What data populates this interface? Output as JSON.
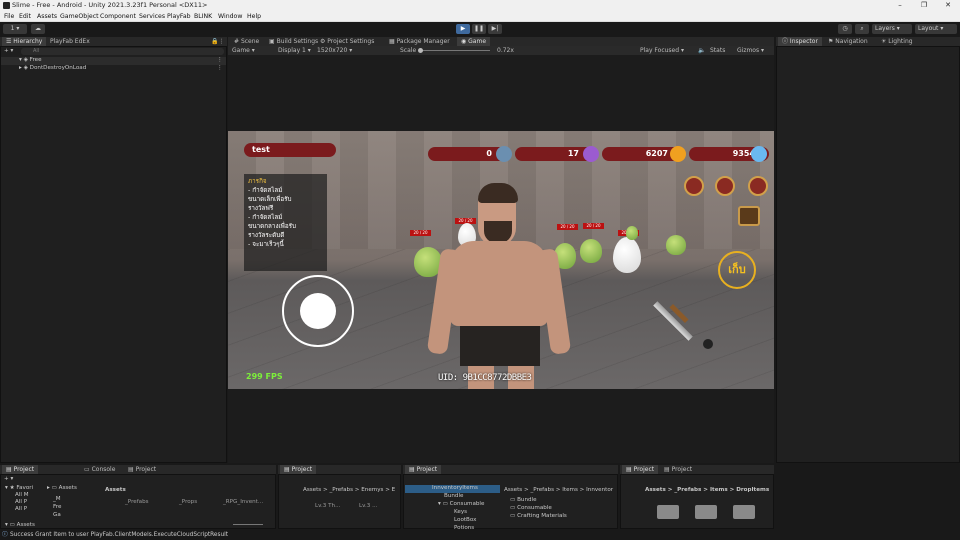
{
  "window": {
    "title": "Slime - Free - Android - Unity 2021.3.23f1 Personal <DX11>"
  },
  "menu": [
    "File",
    "Edit",
    "Assets",
    "GameObject",
    "Component",
    "Services",
    "PlayFab",
    "BLINK",
    "Window",
    "Help"
  ],
  "toolbar": {
    "account": "1 ▾",
    "layers": "Layers",
    "layout": "Layout"
  },
  "hierarchy": {
    "tabs": [
      "Hierarchy",
      "PlayFab EdEx"
    ],
    "search_placeholder": "All",
    "items": [
      "Free",
      "DontDestroyOnLoad"
    ]
  },
  "center_tabs": [
    "Scene",
    "Build Settings",
    "Project Settings",
    "Package Manager",
    "Game"
  ],
  "game_toolbar": {
    "mode": "Game",
    "display": "Display 1",
    "resolution": "1520x720",
    "scale_label": "Scale",
    "scale_value": "0.72x",
    "play_focused": "Play Focused",
    "stats": "Stats",
    "gizmos": "Gizmos"
  },
  "inspector_tabs": [
    "Inspector",
    "Navigation",
    "Lighting"
  ],
  "game": {
    "player_name": "test",
    "currencies": [
      {
        "value": "0",
        "color": "#6b8fb0"
      },
      {
        "value": "17",
        "color": "#9b5bd0"
      },
      {
        "value": "6207",
        "color": "#f0a020"
      },
      {
        "value": "9354",
        "color": "#6ab8f0"
      }
    ],
    "mission_title": "ภารกิจ",
    "mission_lines": [
      "- กำจัดสไลม์",
      "ขนาดเล็กเพื่อรับ",
      "รางวัลฟรี",
      "- กำจัดสไลม์",
      "ขนาดกลางเพื่อรับ",
      "รางวัลระดับดี",
      "- จะมาเร็วๆนี้"
    ],
    "collect_label": "เก็บ",
    "fps": "299 FPS",
    "uid": "UID: 9B1CC8772DBBE3",
    "hp": [
      "20 / 20",
      "20 / 20",
      "20 / 20",
      "20 / 20",
      "20 / 20"
    ]
  },
  "bottom_panels": [
    {
      "tabs": [
        "Project",
        "Console",
        "Project"
      ],
      "breadcrumb": "Assets",
      "tree": [
        "Favori",
        "All M",
        "All P",
        "All P",
        "Assets"
      ],
      "folders": [
        "_M",
        "Fre",
        "Ga"
      ],
      "assets": [
        "_Prefabs",
        "_Props",
        "_RPG_Invent..."
      ]
    },
    {
      "tabs": [
        "Project"
      ],
      "breadcrumb": "Assets > _Prefabs > Enemys > E",
      "items": [
        "Lv.3 Th...",
        "Lv.3 ..."
      ]
    },
    {
      "tabs": [
        "Project"
      ],
      "tree_root": "InnventoryItems",
      "tree": [
        "Bundle",
        "Consumable",
        "Keys",
        "LootBox",
        "Potions"
      ],
      "breadcrumb": "Assets > _Prefabs > Items > Innventor",
      "folders": [
        "Bundle",
        "Consumable",
        "Crafting Materials"
      ]
    },
    {
      "tabs": [
        "Project",
        "Project"
      ],
      "breadcrumb": "Assets > _Prefabs > Items > DropItems"
    }
  ],
  "status": "Success Grant Item to user PlayFab.ClientModels.ExecuteCloudScriptResult"
}
